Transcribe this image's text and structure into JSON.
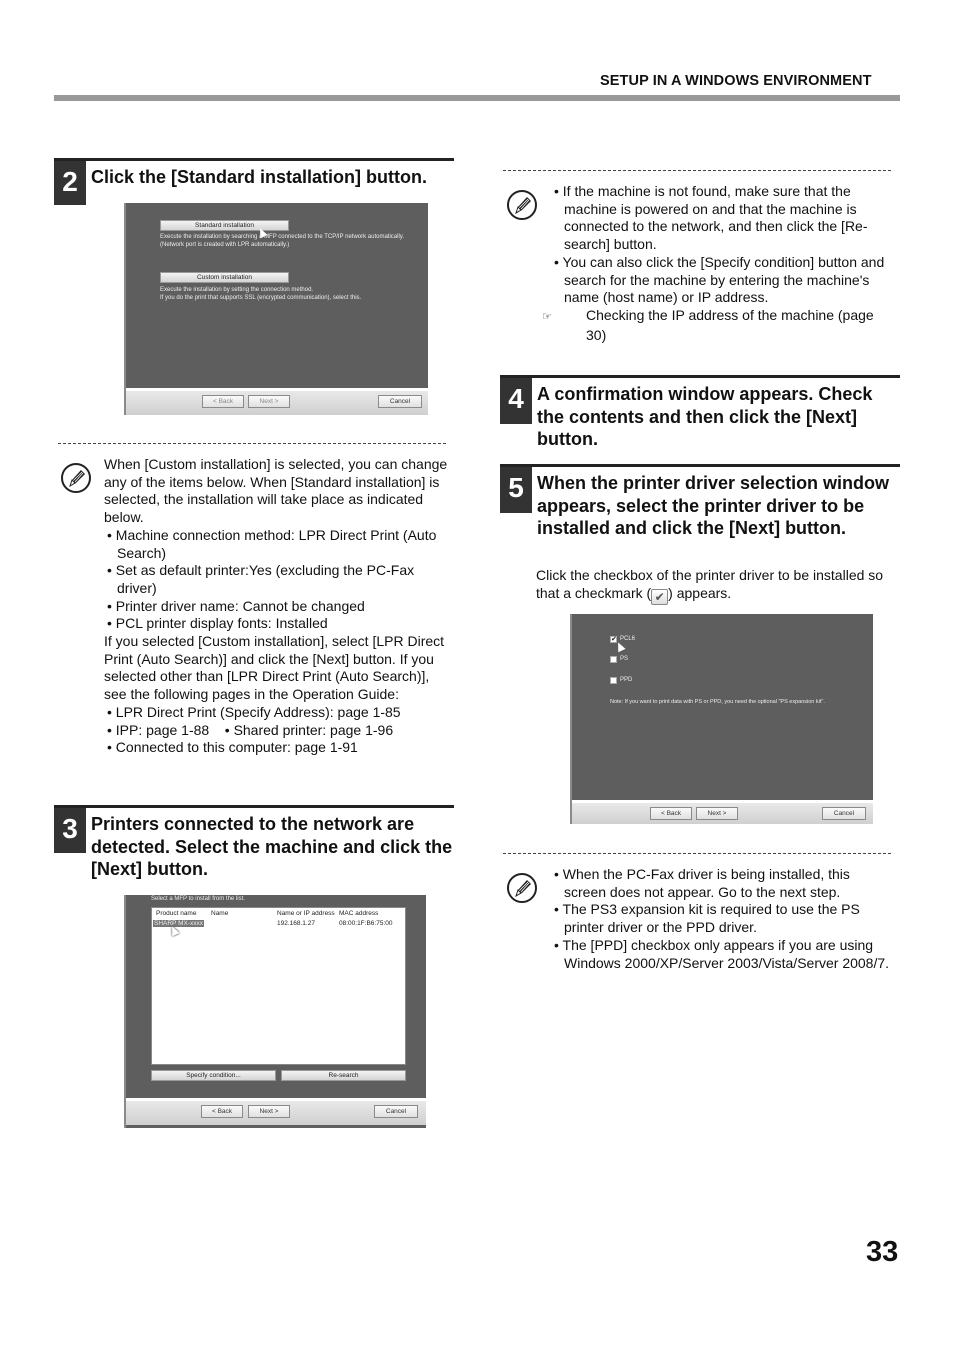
{
  "header": {
    "section_title": "SETUP IN A WINDOWS ENVIRONMENT"
  },
  "page_number": "33",
  "steps": [
    {
      "number": "2",
      "text": "Click the [Standard installation] button."
    },
    {
      "number": "3",
      "text": "Printers connected to the network are detected. Select the machine and click the [Next] button."
    },
    {
      "number": "4",
      "text": "A confirmation window appears. Check the contents and then click the [Next] button."
    },
    {
      "number": "5",
      "text": "When the printer driver selection window appears, select the printer driver to be installed and click the [Next] button."
    }
  ],
  "step5_body": {
    "before": "Click the checkbox of the printer driver to be installed so that a checkmark (",
    "after": ") appears."
  },
  "note1": {
    "intro": "When [Custom installation] is selected, you can change any of the items below. When [Standard installation] is selected, the installation will take place as indicated below.",
    "bullets": [
      "Machine connection method: LPR Direct Print (Auto Search)",
      "Set as default printer:Yes (excluding the PC-Fax driver)",
      "Printer driver name: Cannot be changed",
      "PCL printer display fonts: Installed"
    ],
    "para": "If you selected [Custom installation], select [LPR Direct Print (Auto Search)] and click the [Next] button. If you selected other than [LPR Direct Print (Auto Search)], see the following pages in the Operation Guide:",
    "refs": [
      "LPR Direct Print (Specify Address): page 1-85",
      "IPP: page 1-88",
      "Shared printer: page 1-96",
      "Connected to this computer: page 1-91"
    ]
  },
  "note2": {
    "bullets": [
      "If the machine is not found, make sure that the machine is powered on and that the machine is connected to the network, and then click the [Re-search] button.",
      "You can also click the [Specify condition] button and search for the machine by entering the machine's name (host name) or IP address."
    ],
    "reference": "Checking the IP address of the machine (page 30)"
  },
  "note3": {
    "bullets": [
      "When the PC-Fax driver is being installed, this screen does not appear. Go to the next step.",
      "The PS3 expansion kit is required to use the PS printer driver or the PPD driver.",
      "The [PPD] checkbox only appears if you are using Windows 2000/XP/Server 2003/Vista/Server 2008/7."
    ]
  },
  "screen_install_type": {
    "standard_button": "Standard installation",
    "standard_desc": [
      "Execute the installation by searching a MFP connected to the TCP/IP network automatically.",
      "(Network port is created with LPR automatically.)"
    ],
    "custom_button": "Custom installation",
    "custom_desc": [
      "Execute the installation by setting the connection method.",
      "If you do the print that supports SSL (encrypted communication), select this."
    ],
    "back": "< Back",
    "next": "Next >",
    "cancel": "Cancel"
  },
  "screen_select_mfp": {
    "instruction": "Select a MFP to install from the list.",
    "columns": [
      "Product name",
      "Name",
      "Name or IP address",
      "MAC address"
    ],
    "rows": [
      {
        "product": "SHARP MX-xxxx",
        "name": "",
        "ip": "192.168.1.27",
        "mac": "08:00:1F:B6:75:00"
      }
    ],
    "specify_button": "Specify condition...",
    "research_button": "Re-search",
    "back": "< Back",
    "next": "Next >",
    "cancel": "Cancel"
  },
  "screen_driver": {
    "options": [
      {
        "label": "PCL6",
        "checked": true
      },
      {
        "label": "PS",
        "checked": false
      },
      {
        "label": "PPD",
        "checked": false
      }
    ],
    "note": "Note: If you want to print data with PS or PPD, you need the optional \"PS expansion kit\".",
    "back": "< Back",
    "next": "Next >",
    "cancel": "Cancel"
  },
  "icons": {
    "note": "pencil-note-icon",
    "reference": "pointing-hand-icon",
    "checkmark": "✔",
    "cursor": "mouse-pointer-icon"
  }
}
